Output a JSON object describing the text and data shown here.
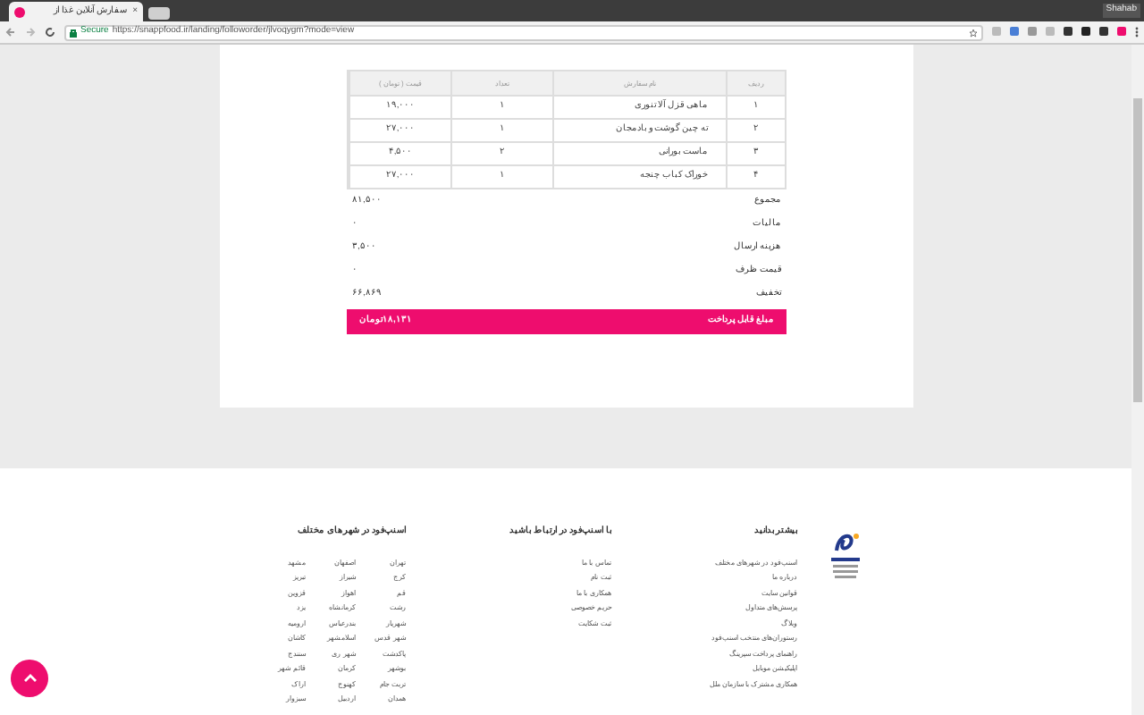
{
  "browser": {
    "tab_title": "سفارش آنلاین غذا از",
    "tab_close": "×",
    "user": "Shahab",
    "secure_label": "Secure",
    "url": "https://snappfood.ir/landing/followorder/jlvoqygm?mode=view"
  },
  "order_table": {
    "columns": [
      "ردیف",
      "نام سفارش",
      "تعداد",
      "قیمت ( تومان )"
    ],
    "rows": [
      [
        "۱",
        "ماهی قزل آلا تنوری",
        "۱",
        "۱۹,۰۰۰"
      ],
      [
        "۲",
        "ته چین گوشت و بادمجان",
        "۱",
        "۲۷,۰۰۰"
      ],
      [
        "۳",
        "ماست بورانی",
        "۲",
        "۴,۵۰۰"
      ],
      [
        "۴",
        "خوراک کباب چنجه",
        "۱",
        "۲۷,۰۰۰"
      ]
    ],
    "summary": [
      {
        "label": "مجموع",
        "value": "۸۱,۵۰۰"
      },
      {
        "label": "مالیات",
        "value": "۰"
      },
      {
        "label": "هزینه ارسال",
        "value": "۳,۵۰۰"
      },
      {
        "label": "قیمت ظرف",
        "value": "۰"
      },
      {
        "label": "تخفیف",
        "value": "۶۶,۸۶۹"
      }
    ],
    "payable": {
      "label": "مبلغ قابل پرداخت",
      "value": "۱۸,۱۳۱تومان"
    }
  },
  "footer": {
    "learn_more": {
      "title": "بیشتر بدانید",
      "links": [
        "اسنپ‌فود در شهرهای مختلف",
        "درباره ما",
        "قوانین سایت",
        "پرسش‌های متداول",
        "وبلاگ",
        "رستوران‌های منتخب اسنپ‌فود",
        "راهنمای پرداخت سپرینگ",
        "اپلیکیشن موبایل",
        "همکاری مشترک با سازمان ملل"
      ]
    },
    "contact": {
      "title": "با اسنپ‌فود در ارتباط باشید",
      "links": [
        "تماس با ما",
        "ثبت نام",
        "همکاری با ما",
        "حریم خصوصی",
        "ثبت شکایت"
      ]
    },
    "cities": {
      "title": "اسنپ‌فود در شهرهای مختلف",
      "columns": [
        [
          "تهران",
          "کرج",
          "قم",
          "رشت",
          "شهریار",
          "شهر قدس",
          "پاکدشت",
          "بوشهر",
          "تربت جام",
          "همدان"
        ],
        [
          "اصفهان",
          "شیراز",
          "اهواز",
          "کرمانشاه",
          "بندرعباس",
          "اسلامشهر",
          "شهر ری",
          "کرمان",
          "کهنوج",
          "اردبیل"
        ],
        [
          "مشهد",
          "تبریز",
          "قزوین",
          "یزد",
          "ارومیه",
          "کاشان",
          "سنندج",
          "قائم شهر",
          "اراک",
          "سبزوار"
        ]
      ]
    }
  }
}
